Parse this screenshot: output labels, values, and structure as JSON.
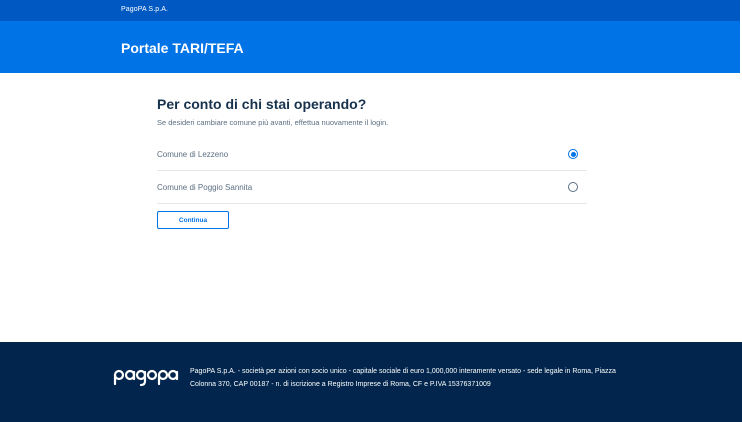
{
  "topbar": {
    "company": "PagoPA S.p.A."
  },
  "header": {
    "title": "Portale TARI/TEFA"
  },
  "main": {
    "title": "Per conto di chi stai operando?",
    "subtitle": "Se desideri cambiare comune più avanti, effettua nuovamente il login.",
    "options": [
      {
        "label": "Comune di Lezzeno",
        "selected": true
      },
      {
        "label": "Comune di Poggio Sannita",
        "selected": false
      }
    ],
    "continue_label": "Continua"
  },
  "footer": {
    "logo_icon": "pagopa-logo-icon",
    "text": "PagoPA S.p.A. - società per azioni con socio unico - capitale sociale di euro 1,000,000 interamente versato - sede legale in Roma, Piazza Colonna 370, CAP 00187 - n. di iscrizione a Registro Imprese di Roma, CF e P.IVA 15376371009"
  },
  "colors": {
    "topbar": "#0059c2",
    "header": "#0073e6",
    "footer": "#01254c",
    "accent": "#0073e6"
  }
}
